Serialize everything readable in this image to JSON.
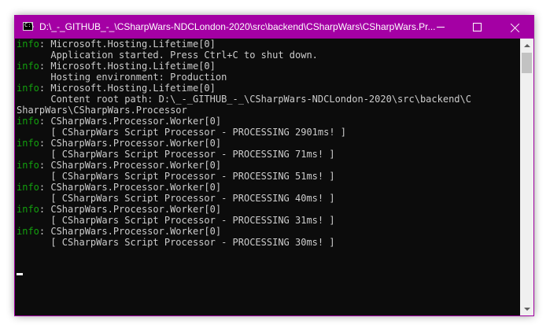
{
  "window": {
    "title": "D:\\_-_GITHUB_-_\\CSharpWars-NDCLondon-2020\\src\\backend\\CSharpWars\\CSharpWars.Pr...",
    "icon": "console-icon",
    "controls": {
      "minimize": "minimize-icon",
      "maximize": "maximize-icon",
      "close": "close-icon"
    },
    "colors": {
      "titlebar": "#a400a4",
      "console_bg": "#0c0c0c",
      "text": "#cccccc",
      "info_level": "#13a10e"
    }
  },
  "console": {
    "lines": [
      {
        "level": "info",
        "text": ": Microsoft.Hosting.Lifetime[0]"
      },
      {
        "level": "",
        "text": "      Application started. Press Ctrl+C to shut down."
      },
      {
        "level": "info",
        "text": ": Microsoft.Hosting.Lifetime[0]"
      },
      {
        "level": "",
        "text": "      Hosting environment: Production"
      },
      {
        "level": "info",
        "text": ": Microsoft.Hosting.Lifetime[0]"
      },
      {
        "level": "",
        "text": "      Content root path: D:\\_-_GITHUB_-_\\CSharpWars-NDCLondon-2020\\src\\backend\\C"
      },
      {
        "level": "",
        "text": "SharpWars\\CSharpWars.Processor"
      },
      {
        "level": "info",
        "text": ": CSharpWars.Processor.Worker[0]"
      },
      {
        "level": "",
        "text": "      [ CSharpWars Script Processor - PROCESSING 2901ms! ]"
      },
      {
        "level": "info",
        "text": ": CSharpWars.Processor.Worker[0]"
      },
      {
        "level": "",
        "text": "      [ CSharpWars Script Processor - PROCESSING 71ms! ]"
      },
      {
        "level": "info",
        "text": ": CSharpWars.Processor.Worker[0]"
      },
      {
        "level": "",
        "text": "      [ CSharpWars Script Processor - PROCESSING 51ms! ]"
      },
      {
        "level": "info",
        "text": ": CSharpWars.Processor.Worker[0]"
      },
      {
        "level": "",
        "text": "      [ CSharpWars Script Processor - PROCESSING 40ms! ]"
      },
      {
        "level": "info",
        "text": ": CSharpWars.Processor.Worker[0]"
      },
      {
        "level": "",
        "text": "      [ CSharpWars Script Processor - PROCESSING 31ms! ]"
      },
      {
        "level": "info",
        "text": ": CSharpWars.Processor.Worker[0]"
      },
      {
        "level": "",
        "text": "      [ CSharpWars Script Processor - PROCESSING 30ms! ]"
      }
    ]
  }
}
